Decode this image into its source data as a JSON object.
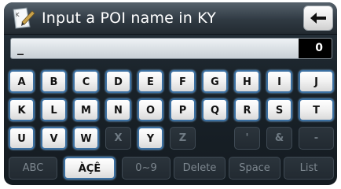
{
  "header": {
    "title": "Input a POI name in KY"
  },
  "input": {
    "value": "_",
    "count": "0"
  },
  "rows": [
    [
      "A",
      "B",
      "C",
      "D",
      "E",
      "F",
      "G",
      "H",
      "I",
      "J"
    ],
    [
      "K",
      "L",
      "M",
      "N",
      "O",
      "P",
      "Q",
      "R",
      "S",
      "T"
    ],
    [
      "U",
      "V",
      "W",
      "X",
      "Y",
      "Z",
      "'",
      "&",
      "-"
    ]
  ],
  "bottom_row": [
    "ABC",
    "ÀÇÊ",
    "0~9",
    "Delete",
    "Space",
    "List"
  ],
  "colors": {
    "accent_border": "#3b6fa0",
    "frame_bg": "#1a232a"
  },
  "icons": {
    "app": "map-book-icon",
    "back": "back-arrow-icon"
  }
}
